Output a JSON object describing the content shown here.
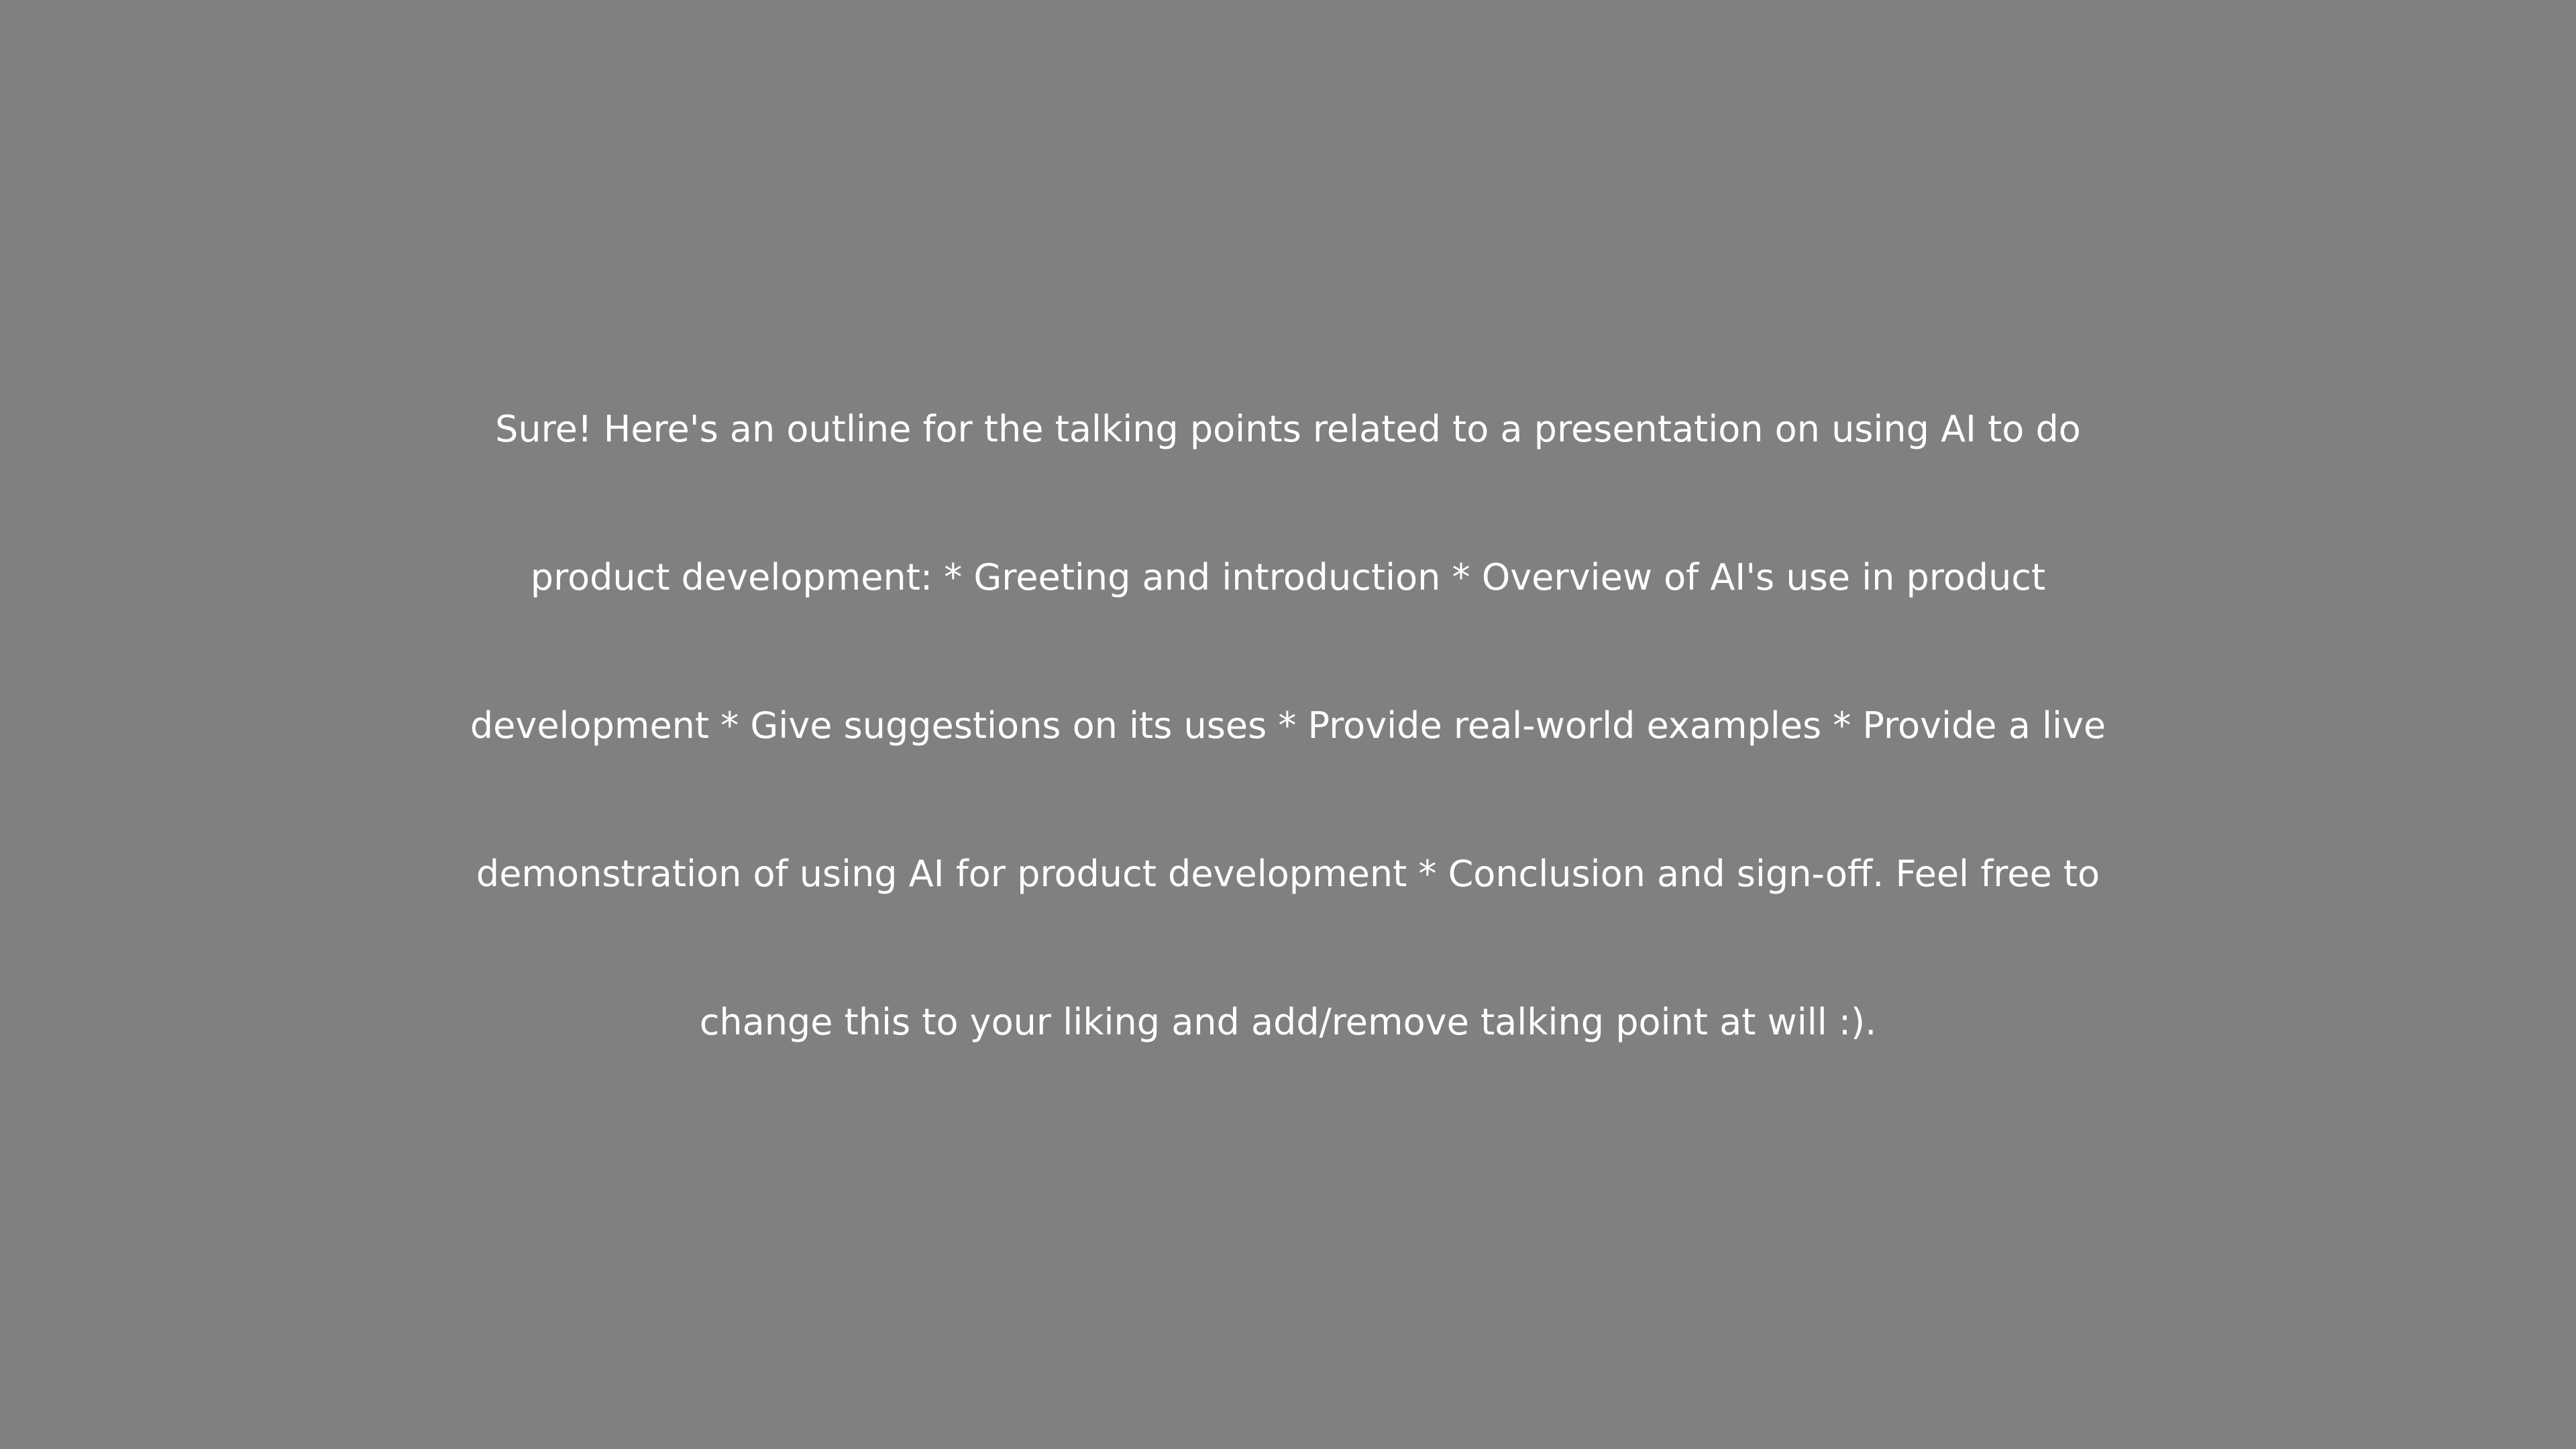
{
  "background_color": "#808080",
  "text_color": "#ffffff",
  "message": {
    "lines": [
      "Sure! Here's an outline for the talking points related to a presentation on using AI to do",
      "product development: * Greeting and introduction * Overview of AI's use in product",
      "development * Give suggestions on its uses * Provide real-world examples * Provide a live",
      "demonstration of using AI for product development * Conclusion and sign-off. Feel free to",
      "change this to your liking and add/remove talking point at will :)."
    ]
  }
}
